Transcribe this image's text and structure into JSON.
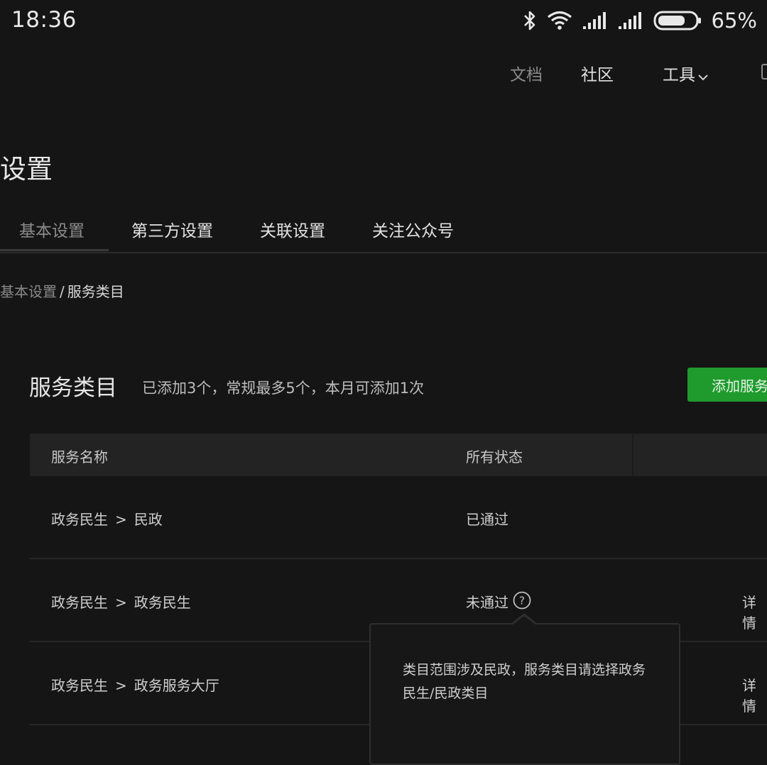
{
  "status_bar": {
    "time": "18:36",
    "battery_percent": "65%",
    "battery_level": 0.65,
    "icons": [
      "bluetooth-icon",
      "wifi-icon",
      "signal-icon",
      "signal-icon",
      "battery-icon"
    ]
  },
  "nav": {
    "docs": "文档",
    "community": "社区",
    "tools": "工具"
  },
  "page_title": "设置",
  "tabs": [
    {
      "label": "基本设置",
      "active": true
    },
    {
      "label": "第三方设置"
    },
    {
      "label": "关联设置"
    },
    {
      "label": "关注公众号"
    }
  ],
  "breadcrumb": {
    "parent": "基本设置",
    "separator": "/",
    "current": "服务类目"
  },
  "section": {
    "title": "服务类目",
    "description": "已添加3个，常规最多5个，本月可添加1次",
    "add_button": "添加服务类目"
  },
  "table": {
    "headers": {
      "name": "服务名称",
      "status": "所有状态"
    },
    "rows": [
      {
        "category": "政务民生",
        "separator": ">",
        "subcategory": "民政",
        "status": "已通过",
        "action": ""
      },
      {
        "category": "政务民生",
        "separator": ">",
        "subcategory": "政务民生",
        "status": "未通过",
        "action": "详情"
      },
      {
        "category": "政务民生",
        "separator": ">",
        "subcategory": "政务服务大厅",
        "status": "",
        "action": "详情"
      }
    ]
  },
  "tooltip": {
    "text": "类目范围涉及民政，服务类目请选择政务民生/民政类目"
  },
  "colors": {
    "background": "#151515",
    "accent_green": "#1f9a2d",
    "header_bg": "#232323"
  }
}
